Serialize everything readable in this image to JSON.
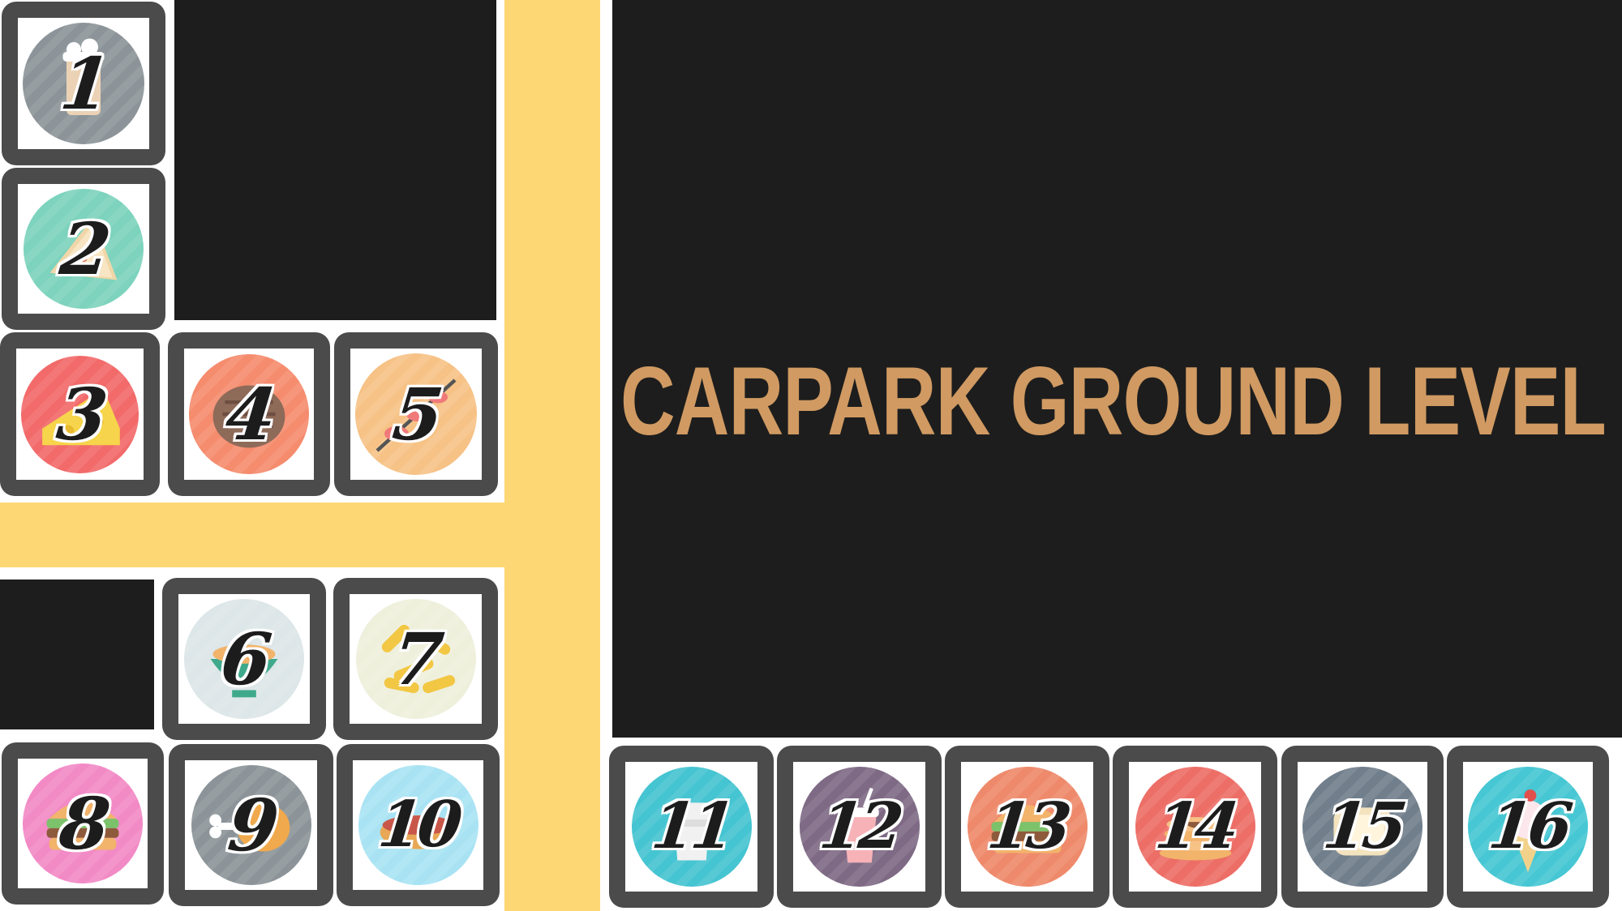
{
  "title": "CARPARK GROUND LEVEL",
  "colors": {
    "road": "#FDD774",
    "block": "#1D1D1D",
    "tile_frame": "#4B4B4B",
    "title": "#D09A62"
  },
  "stalls": [
    {
      "number": "1",
      "icon": "coffee-cup-icon",
      "disc_color": "#8C9499"
    },
    {
      "number": "2",
      "icon": "sandwich-icon",
      "disc_color": "#7DD3BD"
    },
    {
      "number": "3",
      "icon": "cheese-icon",
      "disc_color": "#F26A6A"
    },
    {
      "number": "4",
      "icon": "steak-icon",
      "disc_color": "#F58C6E"
    },
    {
      "number": "5",
      "icon": "skewer-icon",
      "disc_color": "#F6C286"
    },
    {
      "number": "6",
      "icon": "noodle-bowl-icon",
      "disc_color": "#DDE6E8"
    },
    {
      "number": "7",
      "icon": "fries-icon",
      "disc_color": "#EEF0DC"
    },
    {
      "number": "8",
      "icon": "burger-icon",
      "disc_color": "#F28AC6"
    },
    {
      "number": "9",
      "icon": "drumstick-icon",
      "disc_color": "#8C9499"
    },
    {
      "number": "10",
      "icon": "hotdog-icon",
      "disc_color": "#A9E3F3"
    },
    {
      "number": "11",
      "icon": "drink-glass-icon",
      "disc_color": "#45C4D1"
    },
    {
      "number": "12",
      "icon": "milkshake-icon",
      "disc_color": "#7F6A85"
    },
    {
      "number": "13",
      "icon": "burger-icon",
      "disc_color": "#EE8A6B"
    },
    {
      "number": "14",
      "icon": "pancakes-icon",
      "disc_color": "#EC6E66"
    },
    {
      "number": "15",
      "icon": "toast-icon",
      "disc_color": "#717F8C"
    },
    {
      "number": "16",
      "icon": "ice-cream-icon",
      "disc_color": "#46C7D3"
    }
  ]
}
